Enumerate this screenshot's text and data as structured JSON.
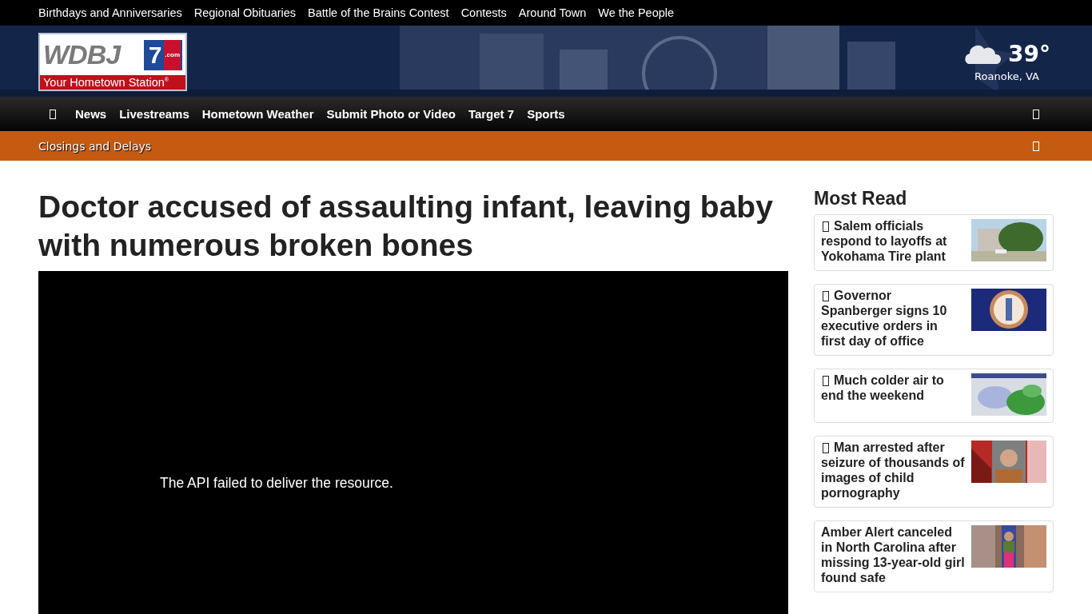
{
  "top_links": [
    "Birthdays and Anniversaries",
    "Regional Obituaries",
    "Battle of the Brains Contest",
    "Contests",
    "Around Town",
    "We the People"
  ],
  "logo": {
    "name": "WDBJ",
    "number": "7",
    "domain": ".com",
    "tagline": "Your Hometown Station",
    "mark": "®"
  },
  "weather": {
    "temperature": "39°",
    "location": "Roanoke, VA"
  },
  "nav": {
    "items": [
      "News",
      "Livestreams",
      "Hometown Weather",
      "Submit Photo or Video",
      "Target 7",
      "Sports"
    ]
  },
  "alert_bar": {
    "label": "Closings and Delays"
  },
  "article": {
    "headline": "Doctor accused of assaulting infant, leaving baby with numerous broken bones",
    "video_message": "The API failed to deliver the resource."
  },
  "most_read": {
    "title": "Most Read",
    "stories": [
      {
        "title": "Salem officials respond to layoffs at Yokohama Tire plant",
        "icon": true
      },
      {
        "title": "Governor Spanberger signs 10 executive orders in first day of office",
        "icon": true
      },
      {
        "title": "Much colder air to end the weekend",
        "icon": true
      },
      {
        "title": "Man arrested after seizure of thousands of images of child pornography",
        "icon": true
      },
      {
        "title": "Amber Alert canceled in North Carolina after missing 13-year-old girl found safe",
        "icon": false
      }
    ]
  }
}
